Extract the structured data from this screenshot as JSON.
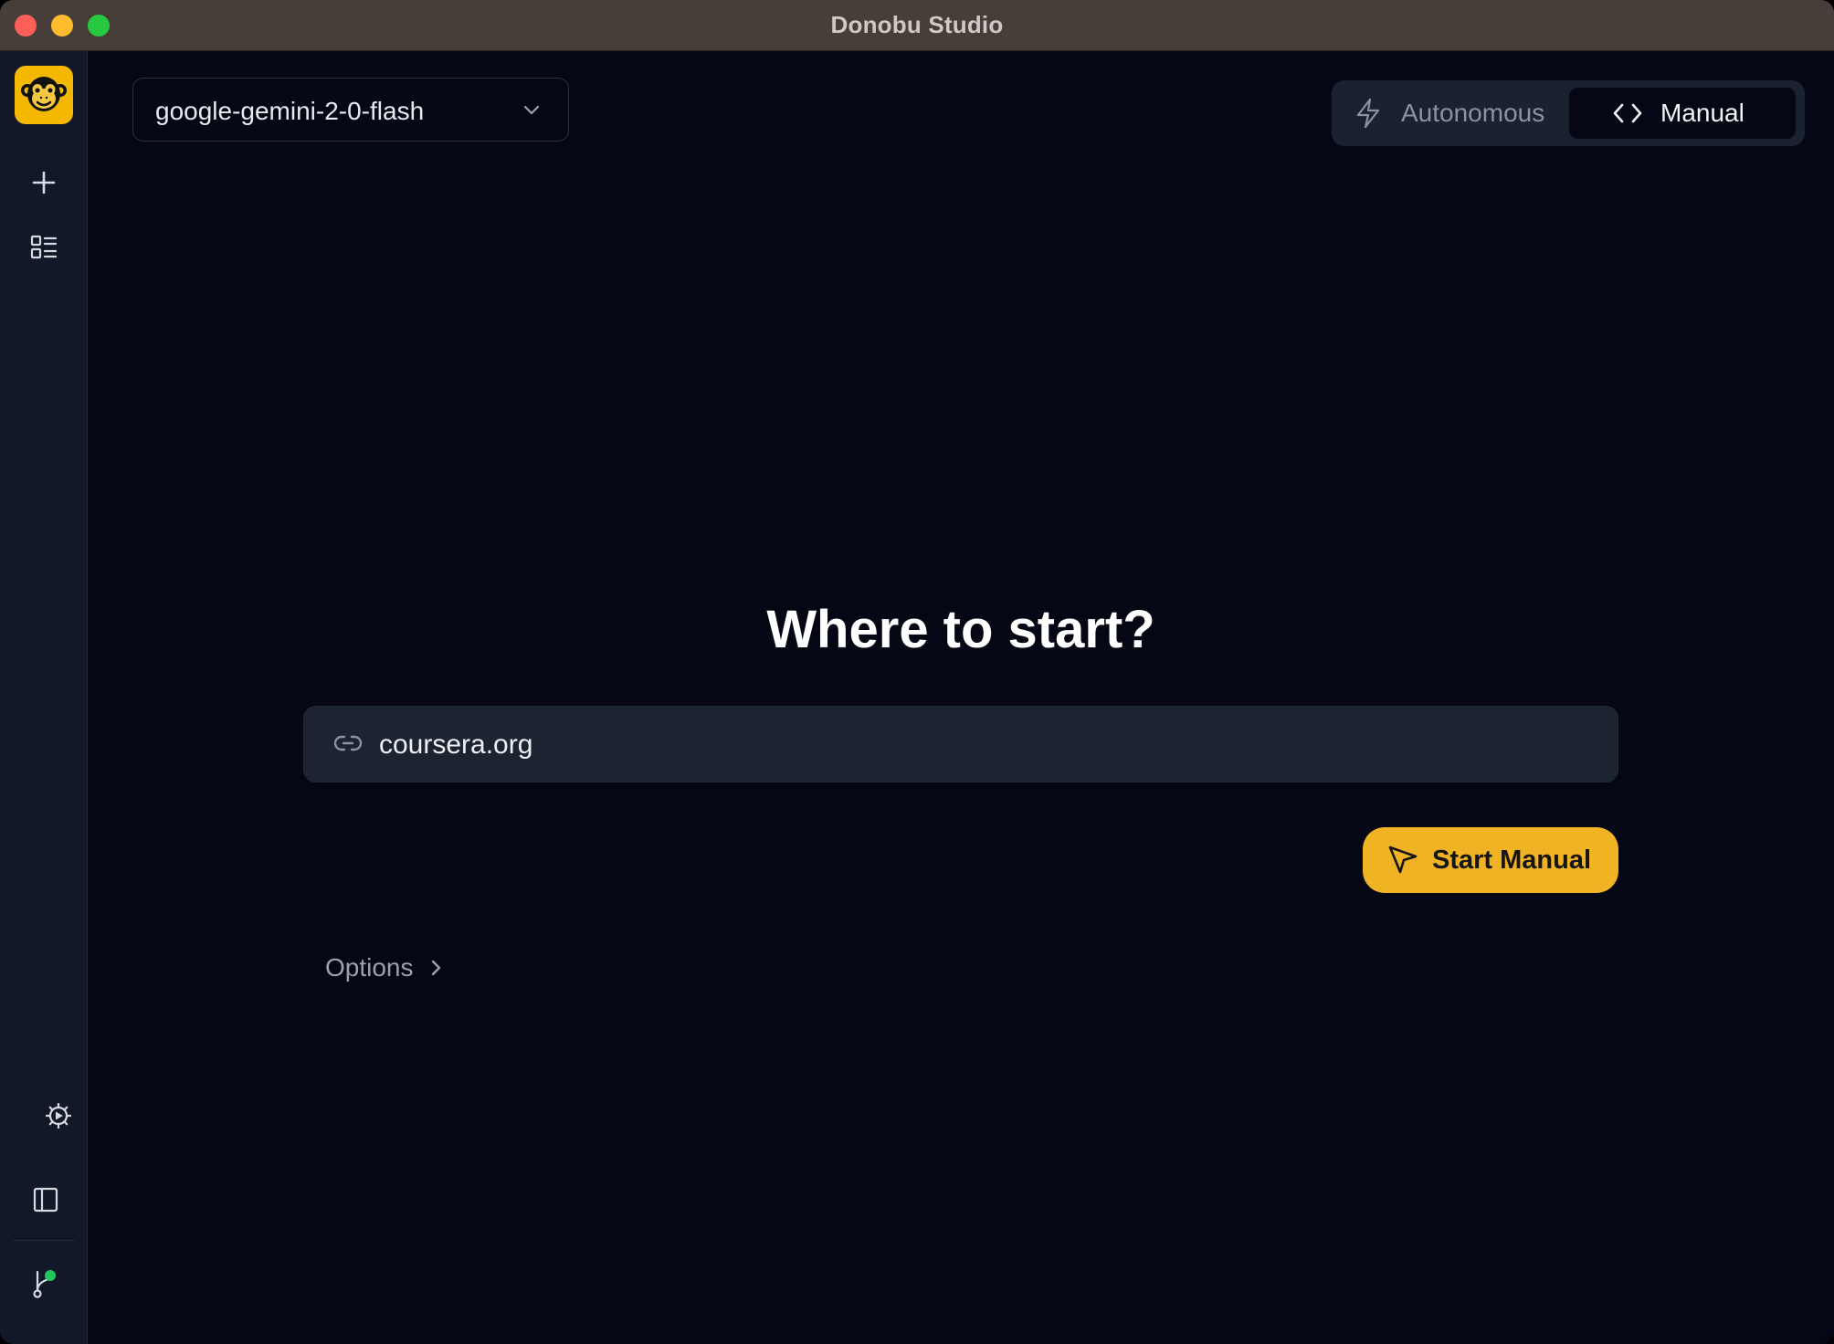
{
  "window": {
    "title": "Donobu Studio"
  },
  "sidebar": {
    "logo_icon": "monkey-logo-icon",
    "items": [
      {
        "icon": "plus-icon"
      },
      {
        "icon": "flows-list-icon"
      },
      {
        "icon": "settings-gear-icon"
      },
      {
        "icon": "sidebar-panel-icon"
      },
      {
        "icon": "git-branch-status-icon",
        "status_color": "#22c55e"
      }
    ]
  },
  "model_selector": {
    "value": "google-gemini-2-0-flash"
  },
  "mode_toggle": {
    "autonomous_label": "Autonomous",
    "manual_label": "Manual",
    "selected": "Manual"
  },
  "main": {
    "heading": "Where to start?",
    "url_input": {
      "value": "coursera.org"
    },
    "start_button_label": "Start Manual",
    "options_label": "Options"
  },
  "colors": {
    "accent": "#f0b323",
    "background": "#050814",
    "sidebar": "#111827",
    "input": "#1c2331"
  }
}
